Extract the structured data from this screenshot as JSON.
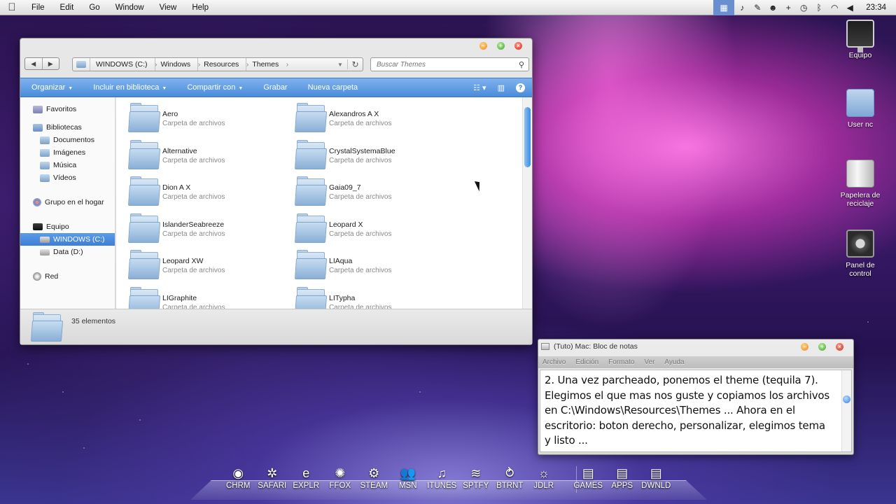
{
  "menubar": {
    "items": [
      "File",
      "Edit",
      "Go",
      "Window",
      "View",
      "Help"
    ],
    "clock": "23:34"
  },
  "explorer": {
    "breadcrumb": [
      "WINDOWS (C:)",
      "Windows",
      "Resources",
      "Themes"
    ],
    "search_placeholder": "Buscar Themes",
    "toolbar": {
      "organize": "Organizar",
      "include": "Incluir en biblioteca",
      "share": "Compartir con",
      "burn": "Grabar",
      "new_folder": "Nueva carpeta"
    },
    "nav": {
      "favorites": "Favoritos",
      "libraries": "Bibliotecas",
      "documents": "Documentos",
      "images": "Imágenes",
      "music": "Música",
      "videos": "Vídeos",
      "homegroup": "Grupo en el hogar",
      "computer": "Equipo",
      "drive_c": "WINDOWS (C:)",
      "drive_d": "Data (D:)",
      "network": "Red"
    },
    "items": [
      {
        "name": "Aero",
        "type": "Carpeta de archivos"
      },
      {
        "name": "Alexandros A  X",
        "type": "Carpeta de archivos"
      },
      {
        "name": "Alternative",
        "type": "Carpeta de archivos"
      },
      {
        "name": "CrystalSystemaBlue",
        "type": "Carpeta de archivos"
      },
      {
        "name": "Dion  A  X",
        "type": "Carpeta de archivos"
      },
      {
        "name": "Gaia09_7",
        "type": "Carpeta de archivos"
      },
      {
        "name": "IslanderSeabreeze",
        "type": "Carpeta de archivos"
      },
      {
        "name": "Leopard X",
        "type": "Carpeta de archivos"
      },
      {
        "name": "Leopard XW",
        "type": "Carpeta de archivos"
      },
      {
        "name": "LIAqua",
        "type": "Carpeta de archivos"
      },
      {
        "name": "LIGraphite",
        "type": "Carpeta de archivos"
      },
      {
        "name": "LITypha",
        "type": "Carpeta de archivos"
      }
    ],
    "status": "35 elementos"
  },
  "desktop": {
    "icons": [
      "Equipo",
      "User nc",
      "Papelera de reciclaje",
      "Panel de control"
    ]
  },
  "notepad": {
    "title": "(Tuto) Mac: Bloc de notas",
    "menu": [
      "Archivo",
      "Edición",
      "Formato",
      "Ver",
      "Ayuda"
    ],
    "text": "2. Una vez parcheado, ponemos el theme (tequila 7). Elegimos el que mas nos guste y copiamos los archivos en C:\\Windows\\Resources\\Themes ... Ahora en el escritorio: boton derecho, personalizar, elegimos tema y listo ..."
  },
  "dock": {
    "items": [
      "CHRM",
      "SAFARI",
      "EXPLR",
      "FFOX",
      "STEAM",
      "MSN",
      "ITUNES",
      "SPTFY",
      "BTRNT",
      "JDLR",
      "GAMES",
      "APPS",
      "DWNLD"
    ]
  }
}
